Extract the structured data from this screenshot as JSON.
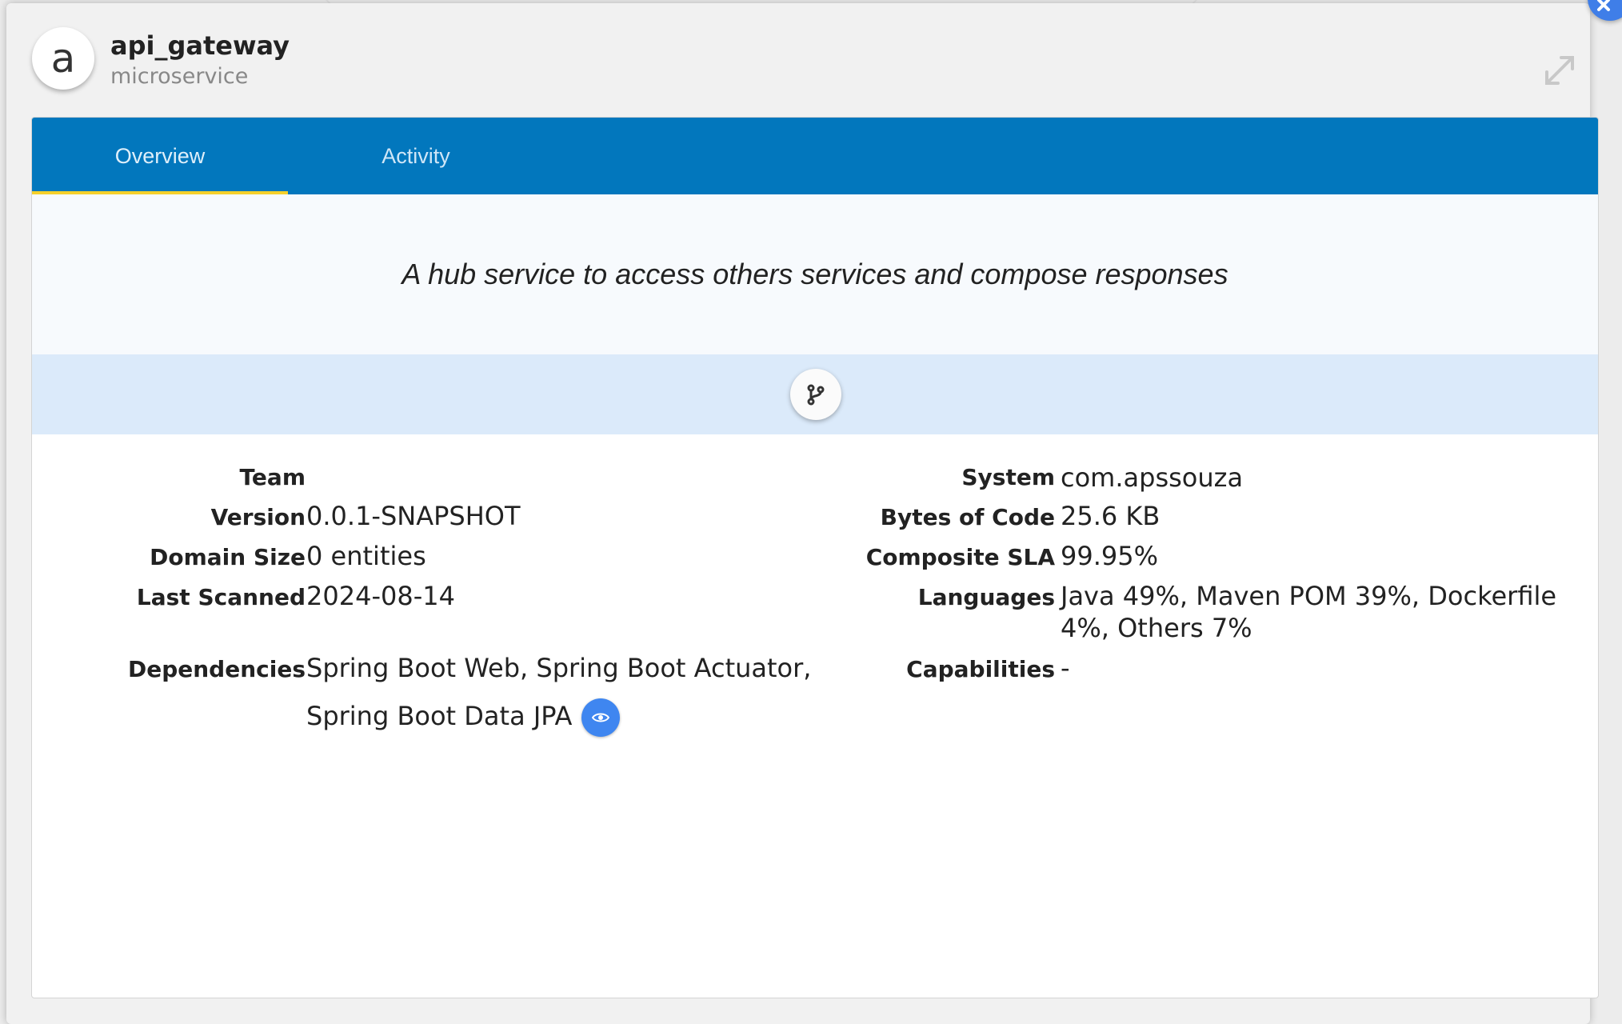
{
  "header": {
    "avatar_letter": "a",
    "title": "api_gateway",
    "subtitle": "microservice"
  },
  "tabs": [
    {
      "label": "Overview",
      "active": true
    },
    {
      "label": "Activity",
      "active": false
    }
  ],
  "description": "A hub service to access others services and compose responses",
  "details": {
    "team": {
      "label": "Team",
      "value": ""
    },
    "version": {
      "label": "Version",
      "value": "0.0.1-SNAPSHOT"
    },
    "domain_size": {
      "label": "Domain Size",
      "value": "0 entities"
    },
    "last_scanned": {
      "label": "Last Scanned",
      "value": "2024-08-14"
    },
    "dependencies": {
      "label": "Dependencies",
      "value_line1": "Spring Boot Web, Spring Boot Actuator,",
      "value_line2": "Spring Boot Data JPA"
    },
    "system": {
      "label": "System",
      "value": "com.apssouza"
    },
    "bytes_of_code": {
      "label": "Bytes of Code",
      "value": "25.6 KB"
    },
    "composite_sla": {
      "label": "Composite SLA",
      "value": "99.95%"
    },
    "languages": {
      "label": "Languages",
      "value_line1": "Java 49%, Maven POM 39%, Dockerfile",
      "value_line2": "4%, Others 7%"
    },
    "capabilities": {
      "label": "Capabilities",
      "value": "-"
    }
  },
  "colors": {
    "tab_bar": "#0277bd",
    "tab_indicator": "#f5d02b",
    "git_band": "#dbeafa",
    "eye_button": "#3f86f0",
    "close_button": "#3f7ee8"
  },
  "icons": {
    "git": "git-branch-icon",
    "eye": "eye-icon",
    "expand": "expand-icon",
    "close": "close-icon"
  }
}
